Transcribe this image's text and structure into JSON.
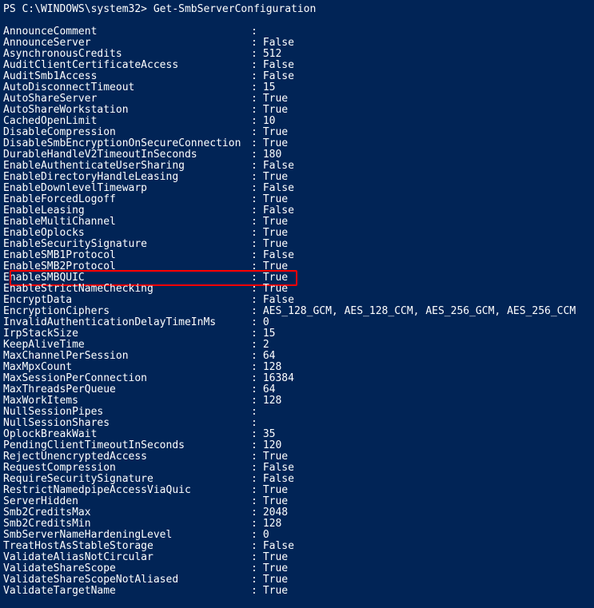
{
  "prompt": "PS C:\\WINDOWS\\system32> Get-SmbServerConfiguration",
  "highlight_key": "EnableSMBQUIC",
  "properties": [
    {
      "key": "AnnounceComment",
      "value": ""
    },
    {
      "key": "AnnounceServer",
      "value": "False"
    },
    {
      "key": "AsynchronousCredits",
      "value": "512"
    },
    {
      "key": "AuditClientCertificateAccess",
      "value": "False"
    },
    {
      "key": "AuditSmb1Access",
      "value": "False"
    },
    {
      "key": "AutoDisconnectTimeout",
      "value": "15"
    },
    {
      "key": "AutoShareServer",
      "value": "True"
    },
    {
      "key": "AutoShareWorkstation",
      "value": "True"
    },
    {
      "key": "CachedOpenLimit",
      "value": "10"
    },
    {
      "key": "DisableCompression",
      "value": "True"
    },
    {
      "key": "DisableSmbEncryptionOnSecureConnection",
      "value": "True"
    },
    {
      "key": "DurableHandleV2TimeoutInSeconds",
      "value": "180"
    },
    {
      "key": "EnableAuthenticateUserSharing",
      "value": "False"
    },
    {
      "key": "EnableDirectoryHandleLeasing",
      "value": "True"
    },
    {
      "key": "EnableDownlevelTimewarp",
      "value": "False"
    },
    {
      "key": "EnableForcedLogoff",
      "value": "True"
    },
    {
      "key": "EnableLeasing",
      "value": "False"
    },
    {
      "key": "EnableMultiChannel",
      "value": "True"
    },
    {
      "key": "EnableOplocks",
      "value": "True"
    },
    {
      "key": "EnableSecuritySignature",
      "value": "True"
    },
    {
      "key": "EnableSMB1Protocol",
      "value": "False"
    },
    {
      "key": "EnableSMB2Protocol",
      "value": "True"
    },
    {
      "key": "EnableSMBQUIC",
      "value": "True"
    },
    {
      "key": "EnableStrictNameChecking",
      "value": "True"
    },
    {
      "key": "EncryptData",
      "value": "False"
    },
    {
      "key": "EncryptionCiphers",
      "value": "AES_128_GCM, AES_128_CCM, AES_256_GCM, AES_256_CCM"
    },
    {
      "key": "InvalidAuthenticationDelayTimeInMs",
      "value": "0"
    },
    {
      "key": "IrpStackSize",
      "value": "15"
    },
    {
      "key": "KeepAliveTime",
      "value": "2"
    },
    {
      "key": "MaxChannelPerSession",
      "value": "64"
    },
    {
      "key": "MaxMpxCount",
      "value": "128"
    },
    {
      "key": "MaxSessionPerConnection",
      "value": "16384"
    },
    {
      "key": "MaxThreadsPerQueue",
      "value": "64"
    },
    {
      "key": "MaxWorkItems",
      "value": "128"
    },
    {
      "key": "NullSessionPipes",
      "value": ""
    },
    {
      "key": "NullSessionShares",
      "value": ""
    },
    {
      "key": "OplockBreakWait",
      "value": "35"
    },
    {
      "key": "PendingClientTimeoutInSeconds",
      "value": "120"
    },
    {
      "key": "RejectUnencryptedAccess",
      "value": "True"
    },
    {
      "key": "RequestCompression",
      "value": "False"
    },
    {
      "key": "RequireSecuritySignature",
      "value": "False"
    },
    {
      "key": "RestrictNamedpipeAccessViaQuic",
      "value": "True"
    },
    {
      "key": "ServerHidden",
      "value": "True"
    },
    {
      "key": "Smb2CreditsMax",
      "value": "2048"
    },
    {
      "key": "Smb2CreditsMin",
      "value": "128"
    },
    {
      "key": "SmbServerNameHardeningLevel",
      "value": "0"
    },
    {
      "key": "TreatHostAsStableStorage",
      "value": "False"
    },
    {
      "key": "ValidateAliasNotCircular",
      "value": "True"
    },
    {
      "key": "ValidateShareScope",
      "value": "True"
    },
    {
      "key": "ValidateShareScopeNotAliased",
      "value": "True"
    },
    {
      "key": "ValidateTargetName",
      "value": "True"
    }
  ]
}
